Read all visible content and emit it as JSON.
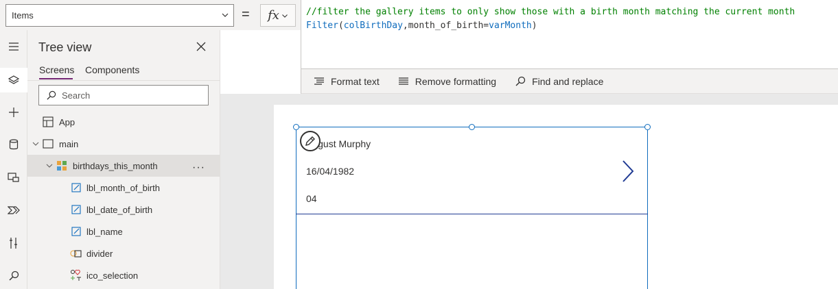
{
  "formula_bar": {
    "property": "Items",
    "equals": "=",
    "code_line1": "//filter the gallery items to only show those with a birth month matching the current month",
    "code_fn": "Filter",
    "code_open": "(",
    "code_arg1": "colBirthDay",
    "code_comma": ",",
    "code_field": "month_of_birth",
    "code_eq": "=",
    "code_var": "varMonth",
    "code_close": ")"
  },
  "formula_toolbar": {
    "format_text": "Format text",
    "remove_formatting": "Remove formatting",
    "find_replace": "Find and replace"
  },
  "tree_view": {
    "title": "Tree view",
    "tabs": [
      "Screens",
      "Components"
    ],
    "search_placeholder": "Search",
    "items": [
      {
        "label": "App"
      },
      {
        "label": "main"
      },
      {
        "label": "birthdays_this_month"
      },
      {
        "label": "lbl_month_of_birth"
      },
      {
        "label": "lbl_date_of_birth"
      },
      {
        "label": "lbl_name"
      },
      {
        "label": "divider"
      },
      {
        "label": "ico_selection"
      }
    ],
    "more": "···"
  },
  "gallery": {
    "name": "August Murphy",
    "date_of_birth": "16/04/1982",
    "month_of_birth": "04"
  },
  "colors": {
    "accent": "#742774",
    "selection": "#0f6cbd",
    "comment": "#008000"
  }
}
